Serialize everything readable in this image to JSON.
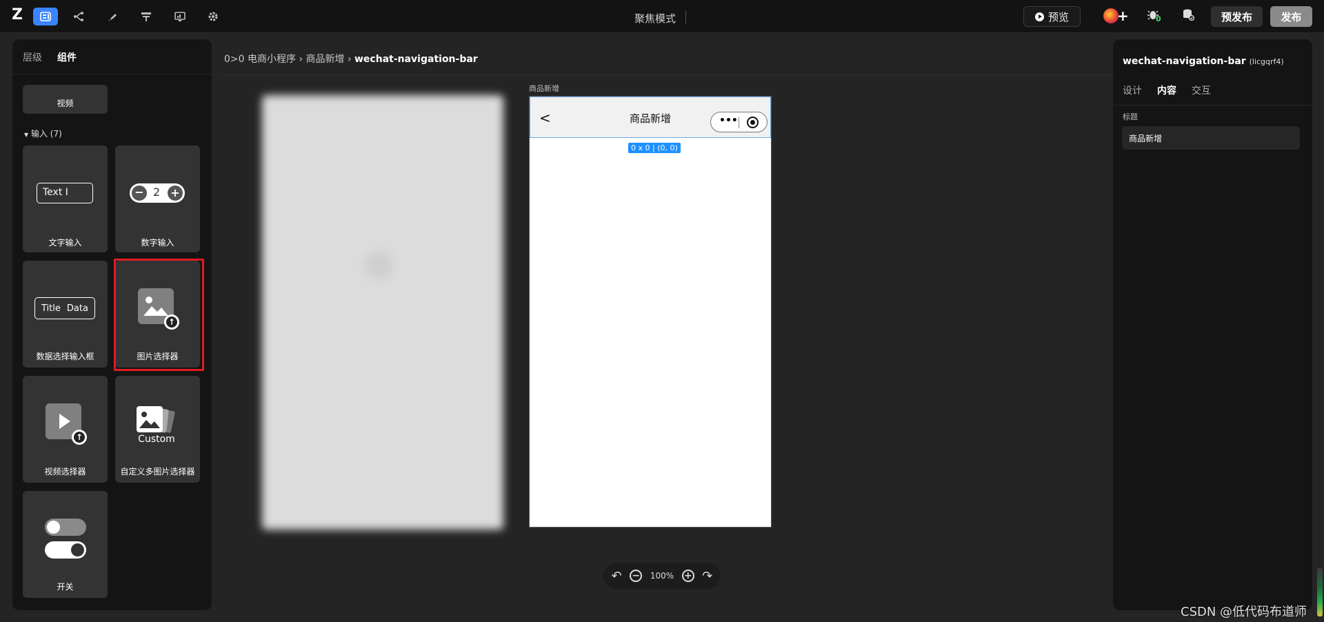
{
  "topbar": {
    "logo": "Z",
    "focus_mode": "聚焦模式",
    "preview_label": "预览",
    "bug_count": "0",
    "prepublish_label": "预发布",
    "publish_label": "发布"
  },
  "left_panel": {
    "tabs": [
      "层级",
      "组件"
    ],
    "active_tab": "组件",
    "partial_card_label": "视频",
    "section": "输入 (7)",
    "components": [
      {
        "label": "文字输入",
        "icon": "text-input-icon",
        "preview": "Text"
      },
      {
        "label": "数字输入",
        "icon": "number-stepper-icon",
        "preview": "2"
      },
      {
        "label": "数据选择输入框",
        "icon": "data-select-icon",
        "preview_a": "Title",
        "preview_b": "Data"
      },
      {
        "label": "图片选择器",
        "icon": "image-picker-icon"
      },
      {
        "label": "视频选择器",
        "icon": "video-picker-icon"
      },
      {
        "label": "自定义多图片选择器",
        "icon": "custom-image-picker-icon",
        "preview": "Custom"
      },
      {
        "label": "开关",
        "icon": "switch-icon"
      }
    ],
    "highlighted": "图片选择器"
  },
  "canvas": {
    "breadcrumb_prefix": "0>0",
    "breadcrumb_items": [
      "电商小程序",
      "商品新增"
    ],
    "breadcrumb_current": "wechat-navigation-bar",
    "frame_label": "商品新增",
    "nav_title": "商品新增",
    "size_badge": "0 x 0 | (0, 0)",
    "zoom": "100%"
  },
  "right_panel": {
    "title": "wechat-navigation-bar",
    "id": "(licgqrf4)",
    "tabs": [
      "设计",
      "内容",
      "交互"
    ],
    "active_tab": "内容",
    "field_label": "标题",
    "field_value": "商品新增"
  },
  "watermark": "CSDN @低代码布道师",
  "colors": {
    "accent": "#3a84ff",
    "highlight": "#e11b22",
    "badge": "#1e90ff"
  }
}
